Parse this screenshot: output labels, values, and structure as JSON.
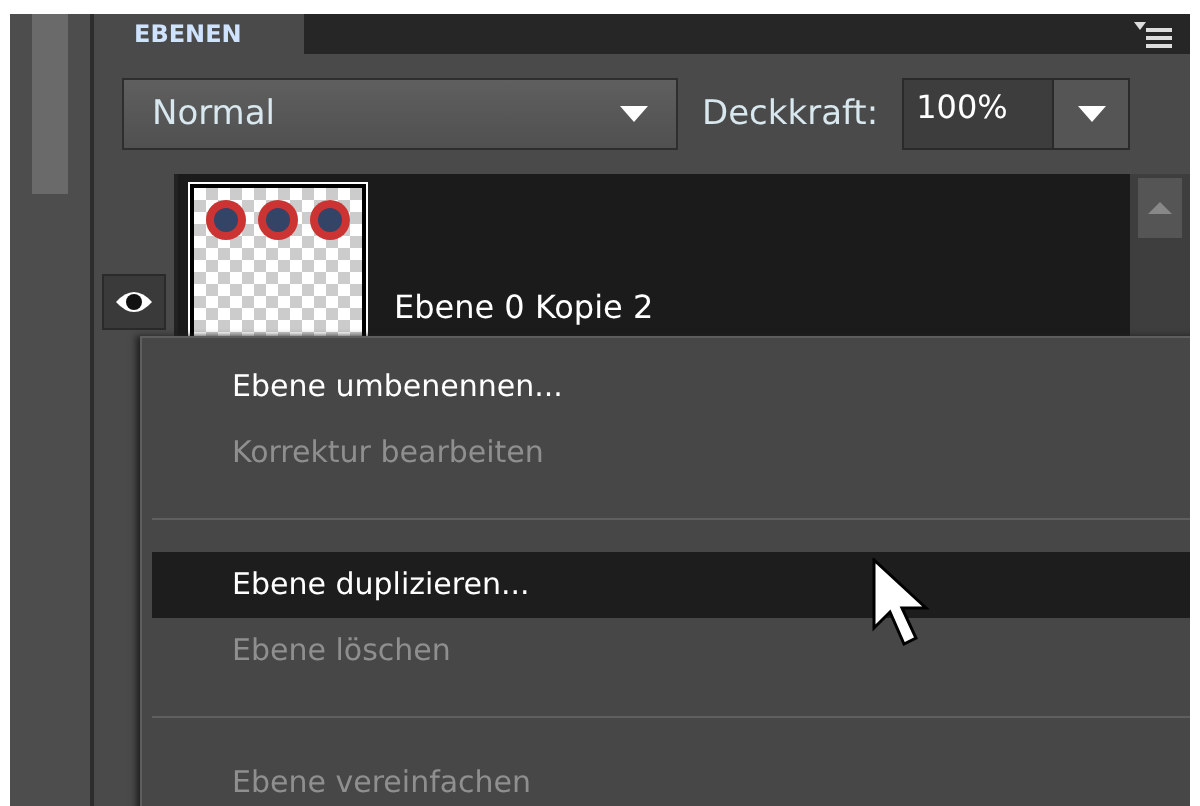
{
  "panel": {
    "tab": "EBENEN"
  },
  "blend_mode": {
    "value": "Normal"
  },
  "opacity": {
    "label": "Deckkraft:",
    "value": "100%"
  },
  "layers": [
    {
      "name": "Ebene 0 Kopie 2",
      "visible": true
    }
  ],
  "context_menu": [
    {
      "kind": "item",
      "label": "Ebene umbenennen...",
      "disabled": false,
      "selected": false
    },
    {
      "kind": "item",
      "label": "Korrektur bearbeiten",
      "disabled": true,
      "selected": false
    },
    {
      "kind": "separator"
    },
    {
      "kind": "item",
      "label": "Ebene duplizieren...",
      "disabled": false,
      "selected": true
    },
    {
      "kind": "item",
      "label": "Ebene löschen",
      "disabled": true,
      "selected": false
    },
    {
      "kind": "separator"
    },
    {
      "kind": "item",
      "label": "Ebene vereinfachen",
      "disabled": true,
      "selected": false
    }
  ]
}
